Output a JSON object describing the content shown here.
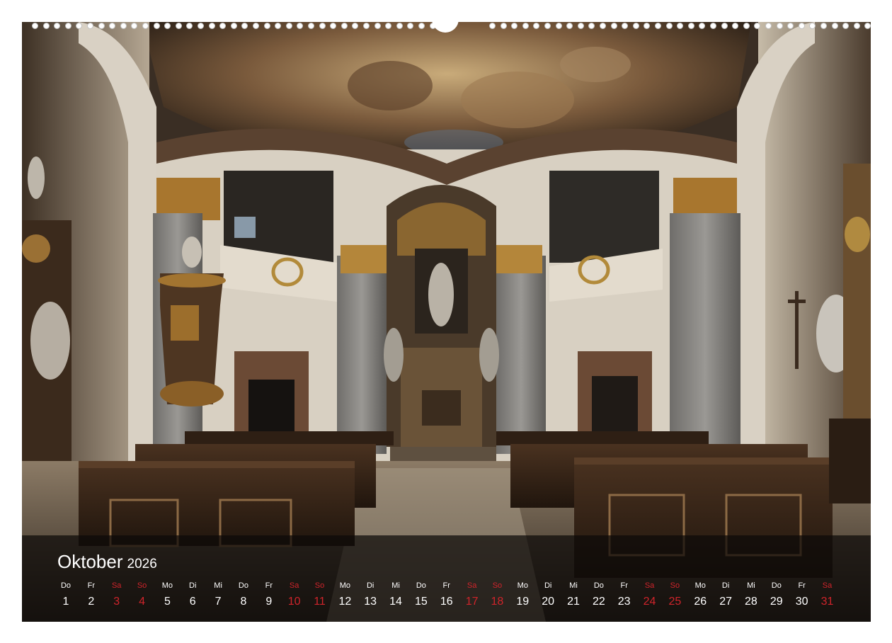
{
  "calendar": {
    "month": "Oktober",
    "year": "2026",
    "weekend_color": "#d0242b",
    "text_color": "#ffffff",
    "days": [
      {
        "name": "Do",
        "num": "1",
        "weekend": false
      },
      {
        "name": "Fr",
        "num": "2",
        "weekend": false
      },
      {
        "name": "Sa",
        "num": "3",
        "weekend": true
      },
      {
        "name": "So",
        "num": "4",
        "weekend": true
      },
      {
        "name": "Mo",
        "num": "5",
        "weekend": false
      },
      {
        "name": "Di",
        "num": "6",
        "weekend": false
      },
      {
        "name": "Mi",
        "num": "7",
        "weekend": false
      },
      {
        "name": "Do",
        "num": "8",
        "weekend": false
      },
      {
        "name": "Fr",
        "num": "9",
        "weekend": false
      },
      {
        "name": "Sa",
        "num": "10",
        "weekend": true
      },
      {
        "name": "So",
        "num": "11",
        "weekend": true
      },
      {
        "name": "Mo",
        "num": "12",
        "weekend": false
      },
      {
        "name": "Di",
        "num": "13",
        "weekend": false
      },
      {
        "name": "Mi",
        "num": "14",
        "weekend": false
      },
      {
        "name": "Do",
        "num": "15",
        "weekend": false
      },
      {
        "name": "Fr",
        "num": "16",
        "weekend": false
      },
      {
        "name": "Sa",
        "num": "17",
        "weekend": true
      },
      {
        "name": "So",
        "num": "18",
        "weekend": true
      },
      {
        "name": "Mo",
        "num": "19",
        "weekend": false
      },
      {
        "name": "Di",
        "num": "20",
        "weekend": false
      },
      {
        "name": "Mi",
        "num": "21",
        "weekend": false
      },
      {
        "name": "Do",
        "num": "22",
        "weekend": false
      },
      {
        "name": "Fr",
        "num": "23",
        "weekend": false
      },
      {
        "name": "Sa",
        "num": "24",
        "weekend": true
      },
      {
        "name": "So",
        "num": "25",
        "weekend": true
      },
      {
        "name": "Mo",
        "num": "26",
        "weekend": false
      },
      {
        "name": "Di",
        "num": "27",
        "weekend": false
      },
      {
        "name": "Mi",
        "num": "28",
        "weekend": false
      },
      {
        "name": "Do",
        "num": "29",
        "weekend": false
      },
      {
        "name": "Fr",
        "num": "30",
        "weekend": false
      },
      {
        "name": "Sa",
        "num": "31",
        "weekend": true
      }
    ]
  }
}
